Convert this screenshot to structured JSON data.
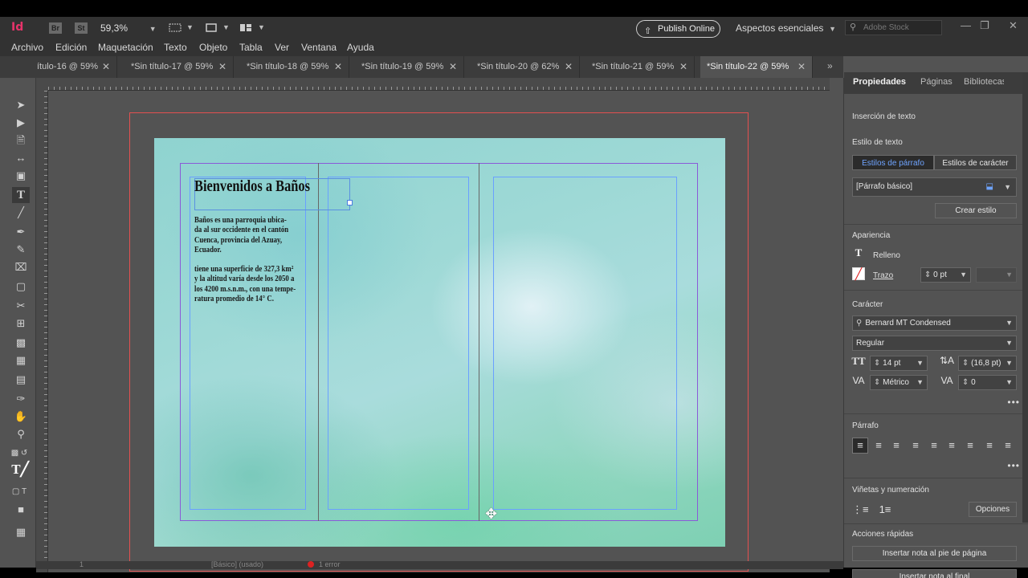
{
  "app": {
    "logo": "Id",
    "bridge": "Br",
    "stock_btn": "St",
    "zoom": "59,3%",
    "publish": "Publish Online",
    "workspace": "Aspectos esenciales",
    "search_placeholder": "Adobe Stock"
  },
  "menu": [
    "Archivo",
    "Edición",
    "Maquetación",
    "Texto",
    "Objeto",
    "Tabla",
    "Ver",
    "Ventana",
    "Ayuda"
  ],
  "tabs": [
    "ítulo-16 @ 59%",
    "*Sin título-17 @ 59%",
    "*Sin título-18 @ 59%",
    "*Sin título-19 @ 59%",
    "*Sin título-20 @ 62%",
    "*Sin título-21 @ 59%",
    "*Sin título-22 @ 59%"
  ],
  "document": {
    "title": "Bienvenidos a Baños",
    "para1": " Baños es una parroquia ubica-\nda al sur occidente en el cantón\nCuenca, provincia del Azuay,\nEcuador.",
    "para2": "tiene una superficie de 327,3 km²\ny la altitud varía desde los 2050 a\nlos 4200 m.s.n.m., con una tempe-\nratura promedio de 14° C."
  },
  "status": {
    "page": "1",
    "style": "[Básico] (usado)",
    "errors": "1 error"
  },
  "panel": {
    "tabs": [
      "Propiedades",
      "Páginas",
      "Bibliotecas"
    ],
    "section_insert": "Inserción de texto",
    "section_textstyle": "Estilo de texto",
    "seg_para": "Estilos de párrafo",
    "seg_char": "Estilos de carácter",
    "para_style": "[Párrafo básico]",
    "create_style": "Crear estilo",
    "section_appearance": "Apariencia",
    "fill": "Relleno",
    "stroke": "Trazo",
    "stroke_weight": "0 pt",
    "section_character": "Carácter",
    "font": "Bernard MT Condensed",
    "font_style": "Regular",
    "font_size": "14 pt",
    "leading": "(16,8 pt)",
    "kerning": "Métrico",
    "tracking": "0",
    "section_paragraph": "Párrafo",
    "section_bullets": "Viñetas y numeración",
    "options": "Opciones",
    "section_quick": "Acciones rápidas",
    "footnote": "Insertar nota al pie de página",
    "endnote": "Insertar nota al final"
  }
}
